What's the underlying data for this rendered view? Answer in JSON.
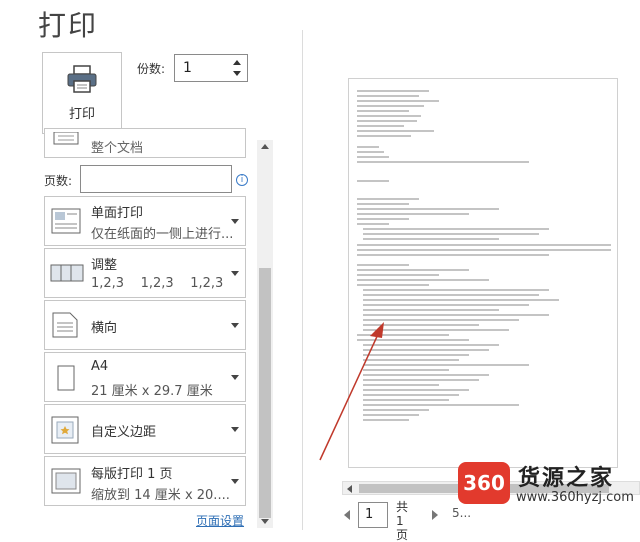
{
  "header": {
    "title": "打印"
  },
  "print_button": {
    "label": "打印",
    "icon": "printer-icon"
  },
  "copies": {
    "label": "份数:",
    "value": "1"
  },
  "pages": {
    "label": "页数:",
    "value": "",
    "info_icon": "info-icon"
  },
  "settings": [
    {
      "id": "range",
      "icon": "document-range-icon",
      "line1": "整个文档"
    },
    {
      "id": "sides",
      "icon": "single-sided-icon",
      "line1": "单面打印",
      "line2": "仅在纸面的一侧上进行..."
    },
    {
      "id": "collate",
      "icon": "collate-icon",
      "line1": "调整",
      "line2": "1,2,3    1,2,3    1,2,3"
    },
    {
      "id": "orientation",
      "icon": "portrait-icon",
      "line1": "横向"
    },
    {
      "id": "paper",
      "icon": "paper-size-icon",
      "line1": "A4",
      "line2": "21 厘米 x 29.7 厘米"
    },
    {
      "id": "margins",
      "icon": "margins-icon",
      "line1": "自定义边距"
    },
    {
      "id": "scaling",
      "icon": "pages-per-sheet-icon",
      "line1": "每版打印 1 页",
      "line2": "缩放到 14 厘米 x 20...."
    }
  ],
  "page_setup_link": "页面设置",
  "pager": {
    "current": "1",
    "total_line1": "共 1",
    "total_line2": "页",
    "zoom_partial": "5..."
  },
  "watermark": {
    "logo_text": "360",
    "brand": "货源之家",
    "url": "www.360hyzj.com"
  },
  "colors": {
    "link": "#2f6fb5",
    "arrow": "#c0392b",
    "logo": "#e23a2d"
  }
}
